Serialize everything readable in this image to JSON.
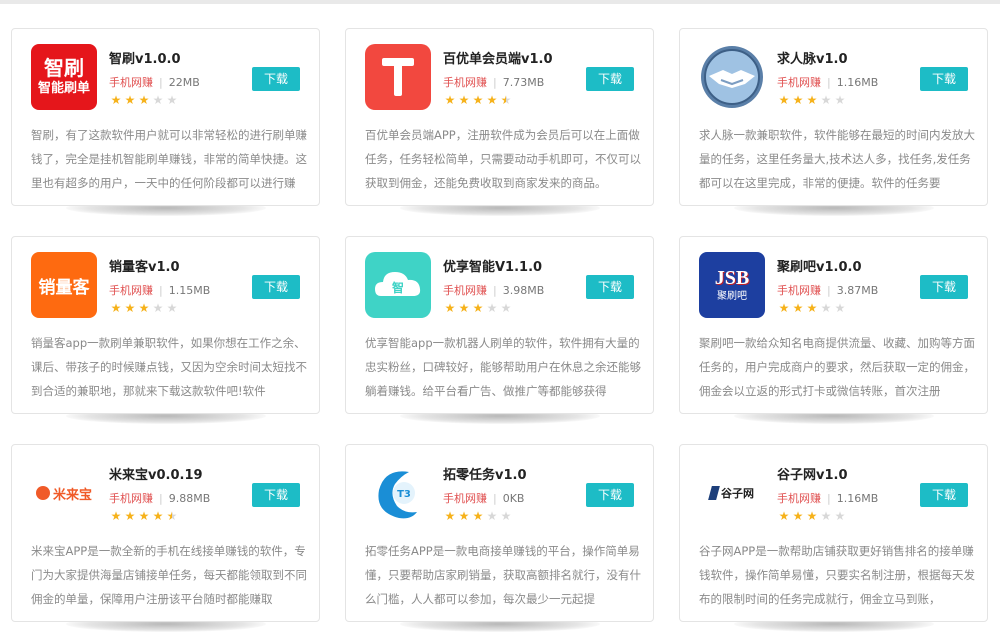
{
  "download_label": "下载",
  "apps": [
    {
      "name": "智刷v1.0.0",
      "category": "手机网赚",
      "size": "22MB",
      "rating": 3,
      "logo": {
        "type": "text",
        "bg": "#e5161b",
        "lines": [
          "智刷",
          "智能刷单"
        ],
        "icon": "zhishua-logo-icon"
      },
      "description": "智刷，有了这款软件用户就可以非常轻松的进行刷单赚钱了，完全是挂机智能刷单赚钱，非常的简单快捷。这里也有超多的用户，一天中的任何阶段都可以进行赚"
    },
    {
      "name": "百优单会员端v1.0",
      "category": "手机网赚",
      "size": "7.73MB",
      "rating": 4.5,
      "logo": {
        "type": "bigT",
        "bg": "#f2483f",
        "icon": "baiyoudan-logo-icon"
      },
      "description": "百优单会员端APP，注册软件成为会员后可以在上面做任务，任务轻松简单，只需要动动手机即可，不仅可以获取到佣金，还能免费收取到商家发来的商品。"
    },
    {
      "name": "求人脉v1.0",
      "category": "手机网赚",
      "size": "1.16MB",
      "rating": 3,
      "logo": {
        "type": "handshake",
        "bg": "#ffffff",
        "icon": "handshake-logo-icon"
      },
      "description": "求人脉一款兼职软件，软件能够在最短的时间内发放大量的任务，这里任务量大,技术达人多，找任务,发任务都可以在这里完成，非常的便捷。软件的任务要"
    },
    {
      "name": "销量客v1.0",
      "category": "手机网赚",
      "size": "1.15MB",
      "rating": 3,
      "logo": {
        "type": "text",
        "bg": "#fe6a10",
        "lines": [
          "销量客"
        ],
        "icon": "xiaoliangke-logo-icon"
      },
      "description": "销量客app一款刷单兼职软件，如果你想在工作之余、课后、带孩子的时候赚点钱，又因为空余时间太短找不到合适的兼职地，那就来下载这款软件吧!软件"
    },
    {
      "name": "优享智能V1.1.0",
      "category": "手机网赚",
      "size": "3.98MB",
      "rating": 3,
      "logo": {
        "type": "cloud",
        "bg": "#3fd3c6",
        "lines": [
          "智"
        ],
        "icon": "cloud-logo-icon"
      },
      "description": "优享智能app一款机器人刷单的软件，软件拥有大量的忠实粉丝，口碑较好，能够帮助用户在休息之余还能够躺着赚钱。给平台看广告、做推广等都能够获得"
    },
    {
      "name": "聚刷吧v1.0.0",
      "category": "手机网赚",
      "size": "3.87MB",
      "rating": 3,
      "logo": {
        "type": "jsb",
        "bg": "#1d3fa0",
        "lines": [
          "JSB",
          "聚刷吧"
        ],
        "icon": "jushuaba-logo-icon"
      },
      "description": "聚刷吧一款给众知名电商提供流量、收藏、加购等方面任务的，用户完成商户的要求，然后获取一定的佣金，佣金会以立返的形式打卡或微信转账，首次注册"
    },
    {
      "name": "米来宝v0.0.19",
      "category": "手机网赚",
      "size": "9.88MB",
      "rating": 4.5,
      "logo": {
        "type": "milai",
        "bg": "#ffffff",
        "lines": [
          "米来宝"
        ],
        "icon": "milaibao-logo-icon"
      },
      "description": "米来宝APP是一款全新的手机在线接单赚钱的软件，专门为大家提供海量店铺接单任务，每天都能领取到不同佣金的单量，保障用户注册该平台随时都能赚取"
    },
    {
      "name": "拓零任务v1.0",
      "category": "手机网赚",
      "size": "0KB",
      "rating": 3,
      "logo": {
        "type": "tuoling",
        "bg": "#ffffff",
        "lines": [
          "T3"
        ],
        "icon": "tuoling-logo-icon"
      },
      "description": "拓零任务APP是一款电商接单赚钱的平台，操作简单易懂，只要帮助店家刷销量，获取高额排名就行，没有什么门槛，人人都可以参加，每次最少一元起提"
    },
    {
      "name": "谷子网v1.0",
      "category": "手机网赚",
      "size": "1.16MB",
      "rating": 3,
      "logo": {
        "type": "guzi",
        "bg": "#ffffff",
        "lines": [
          "谷子网"
        ],
        "icon": "guziwang-logo-icon"
      },
      "description": "谷子网APP是一款帮助店铺获取更好销售排名的接单赚钱软件，操作简单易懂，只要实名制注册，根据每天发布的限制时间的任务完成就行，佣金立马到账，"
    }
  ]
}
